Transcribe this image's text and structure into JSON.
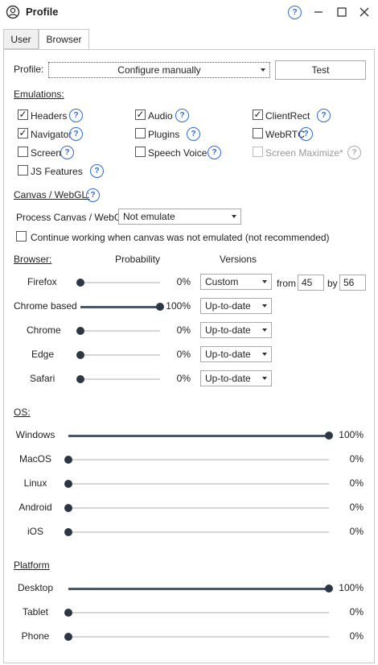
{
  "window": {
    "title": "Profile"
  },
  "tabs": [
    {
      "label": "User"
    },
    {
      "label": "Browser"
    }
  ],
  "profile": {
    "label": "Profile:",
    "value": "Configure manually",
    "test_label": "Test"
  },
  "emulations": {
    "heading": "Emulations:",
    "items": [
      {
        "label": "Headers",
        "checked": true
      },
      {
        "label": "Audio",
        "checked": true
      },
      {
        "label": "ClientRect",
        "checked": true
      },
      {
        "label": "Navigator",
        "checked": true
      },
      {
        "label": "Plugins",
        "checked": false
      },
      {
        "label": "WebRTC",
        "checked": false
      },
      {
        "label": "Screen",
        "checked": false
      },
      {
        "label": "Speech Voice",
        "checked": false
      },
      {
        "label": "Screen Maximize*",
        "checked": false
      },
      {
        "label": "JS Features",
        "checked": false
      }
    ]
  },
  "canvas": {
    "heading": "Canvas / WebGL:",
    "process_label": "Process Canvas / WebGL",
    "process_value": "Not emulate",
    "continue_label": "Continue working when canvas was not emulated (not recommended)"
  },
  "browser": {
    "heading": "Browser:",
    "probability_header": "Probability",
    "versions_header": "Versions",
    "from_label": "from",
    "by_label": "by",
    "from_value": "45",
    "by_value": "56",
    "rows": [
      {
        "name": "Firefox",
        "percent": "0%",
        "level": 0,
        "version": "Custom"
      },
      {
        "name": "Chrome based",
        "percent": "100%",
        "level": 1,
        "version": "Up-to-date"
      },
      {
        "name": "Chrome",
        "percent": "0%",
        "level": 0,
        "version": "Up-to-date"
      },
      {
        "name": "Edge",
        "percent": "0%",
        "level": 0,
        "version": "Up-to-date"
      },
      {
        "name": "Safari",
        "percent": "0%",
        "level": 0,
        "version": "Up-to-date"
      }
    ]
  },
  "os": {
    "heading": "OS:",
    "rows": [
      {
        "name": "Windows",
        "percent": "100%",
        "level": 1
      },
      {
        "name": "MacOS",
        "percent": "0%",
        "level": 0
      },
      {
        "name": "Linux",
        "percent": "0%",
        "level": 0
      },
      {
        "name": "Android",
        "percent": "0%",
        "level": 0
      },
      {
        "name": "iOS",
        "percent": "0%",
        "level": 0
      }
    ]
  },
  "platform": {
    "heading": "Platform",
    "rows": [
      {
        "name": "Desktop",
        "percent": "100%",
        "level": 1
      },
      {
        "name": "Tablet",
        "percent": "0%",
        "level": 0
      },
      {
        "name": "Phone",
        "percent": "0%",
        "level": 0
      }
    ]
  },
  "icons": {
    "user": "user-circle-icon",
    "help": "help-icon",
    "minimize": "minimize-icon",
    "maximize": "maximize-icon",
    "close": "close-icon"
  }
}
